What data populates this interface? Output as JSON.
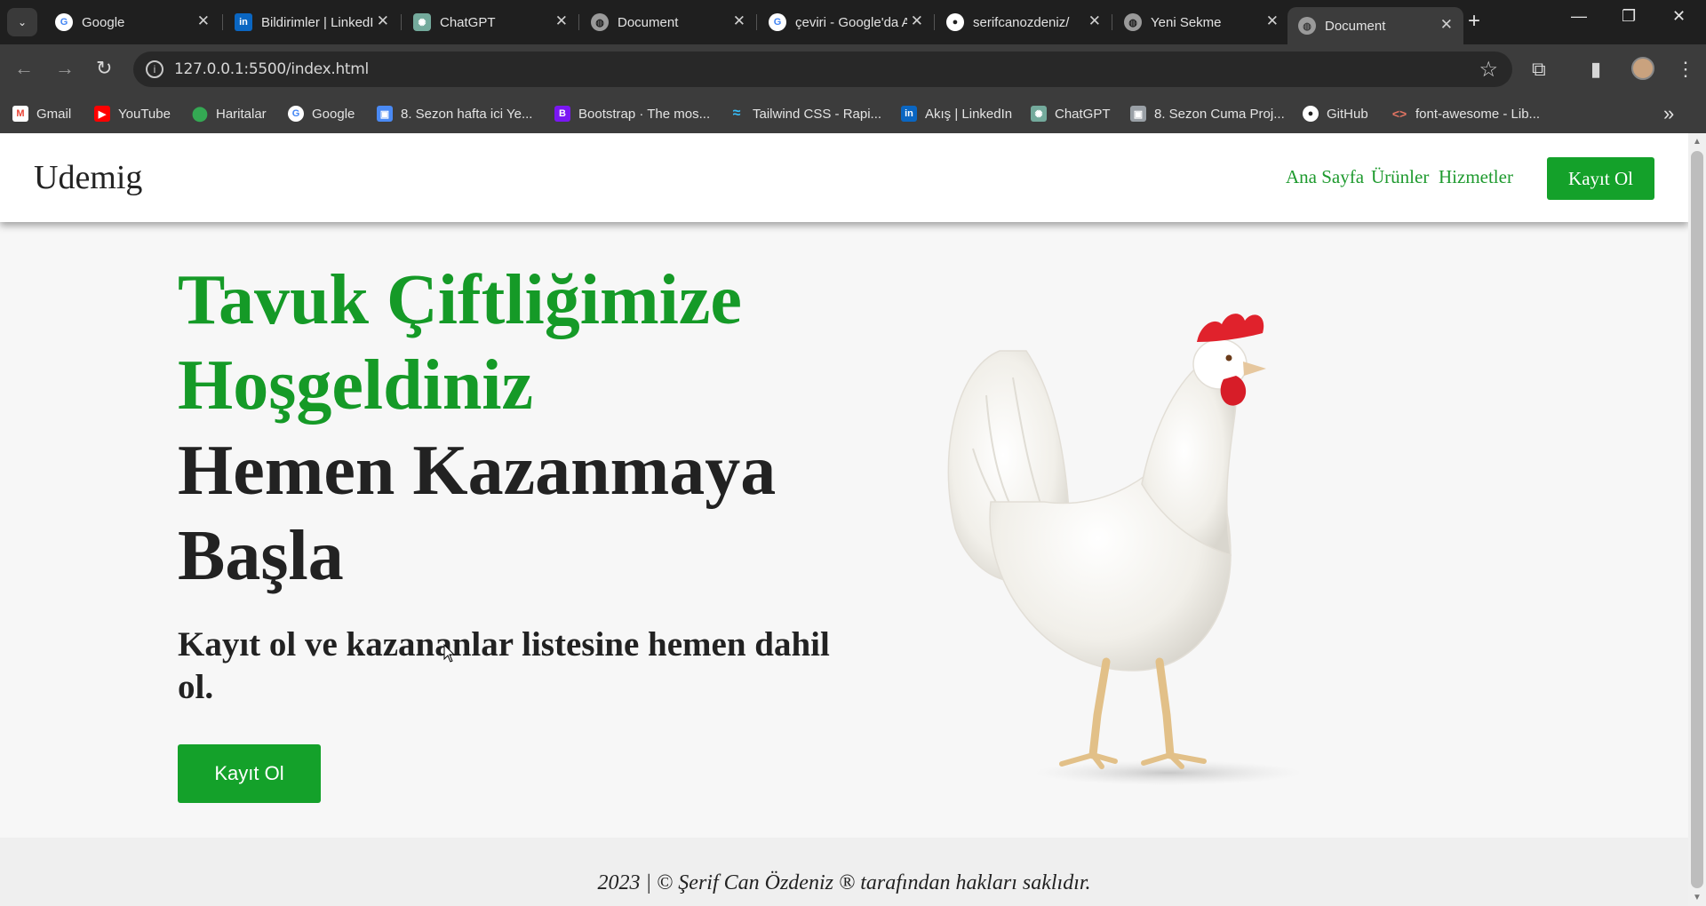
{
  "browser": {
    "tabs": [
      {
        "title": "Google",
        "icon": "google-icon",
        "active": false
      },
      {
        "title": "Bildirimler | LinkedIn",
        "icon": "linkedin-icon",
        "active": false
      },
      {
        "title": "ChatGPT",
        "icon": "chatgpt-icon",
        "active": false
      },
      {
        "title": "Document",
        "icon": "globe-icon",
        "active": false
      },
      {
        "title": "çeviri - Google'da Ara",
        "icon": "google-icon",
        "active": false
      },
      {
        "title": "serifcanozdeniz/",
        "icon": "github-icon",
        "active": false
      },
      {
        "title": "Yeni Sekme",
        "icon": "globe-icon",
        "active": false
      },
      {
        "title": "Document",
        "icon": "globe-icon",
        "active": true
      }
    ],
    "url": "127.0.0.1:5500/index.html",
    "bookmarks": [
      {
        "label": "Gmail",
        "icon": "gmail-icon"
      },
      {
        "label": "YouTube",
        "icon": "youtube-icon"
      },
      {
        "label": "Haritalar",
        "icon": "maps-icon"
      },
      {
        "label": "Google",
        "icon": "google-icon"
      },
      {
        "label": "8. Sezon hafta ici Ye...",
        "icon": "classroom-icon"
      },
      {
        "label": "Bootstrap · The mos...",
        "icon": "bootstrap-icon"
      },
      {
        "label": "Tailwind CSS - Rapi...",
        "icon": "tailwind-icon"
      },
      {
        "label": "Akış | LinkedIn",
        "icon": "linkedin-icon"
      },
      {
        "label": "ChatGPT",
        "icon": "chatgpt-icon"
      },
      {
        "label": "8. Sezon Cuma Proj...",
        "icon": "classroom-icon"
      },
      {
        "label": "GitHub",
        "icon": "github-icon"
      },
      {
        "label": "font-awesome - Lib...",
        "icon": "code-icon"
      }
    ]
  },
  "site": {
    "logo": "Udemig",
    "nav": [
      "Ana Sayfa",
      "Ürünler",
      "Hizmetler"
    ],
    "header_button": "Kayıt Ol",
    "hero": {
      "title_green_line1": "Tavuk Çiftliğimize",
      "title_green_line2": "Hoşgeldiniz",
      "title_dark_line1": "Hemen Kazanmaya",
      "title_dark_line2": "Başla",
      "subtitle": "Kayıt ol ve kazananlar listesine hemen dahil ol.",
      "button": "Kayıt Ol",
      "image": "white-chicken-image"
    },
    "footer": "2023 | © Şerif Can Özdeniz ® tarafından hakları saklıdır."
  },
  "colors": {
    "brand_green": "#14a12a",
    "title_green": "#159a27",
    "text_dark": "#222222"
  }
}
